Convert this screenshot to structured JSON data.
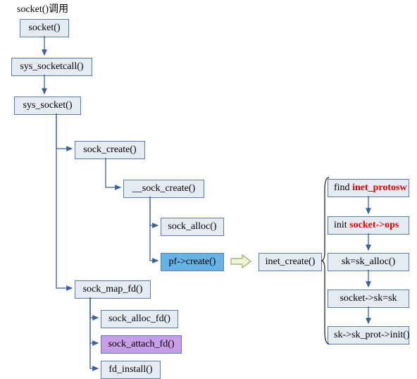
{
  "title": "socket()调用",
  "nodes": {
    "socket": "socket()",
    "sys_socketcall": "sys_socketcall()",
    "sys_socket": "sys_socket()",
    "sock_create": "sock_create()",
    "__sock_create": "__sock_create()",
    "sock_alloc": "sock_alloc()",
    "pf_create": "pf->create()",
    "inet_create": "inet_create()",
    "find": {
      "pre": "find ",
      "em": "inet_protosw"
    },
    "init": {
      "pre": "init ",
      "em": "socket->ops"
    },
    "sk_alloc": "sk=sk_alloc()",
    "socket_sk": "socket->sk=sk",
    "sk_prot_init": "sk->sk_prot->init()",
    "sock_map_fd": "sock_map_fd()",
    "sock_alloc_fd": "sock_alloc_fd()",
    "sock_attach_fd": "sock_attach_fd()",
    "fd_install": "fd_install()"
  }
}
